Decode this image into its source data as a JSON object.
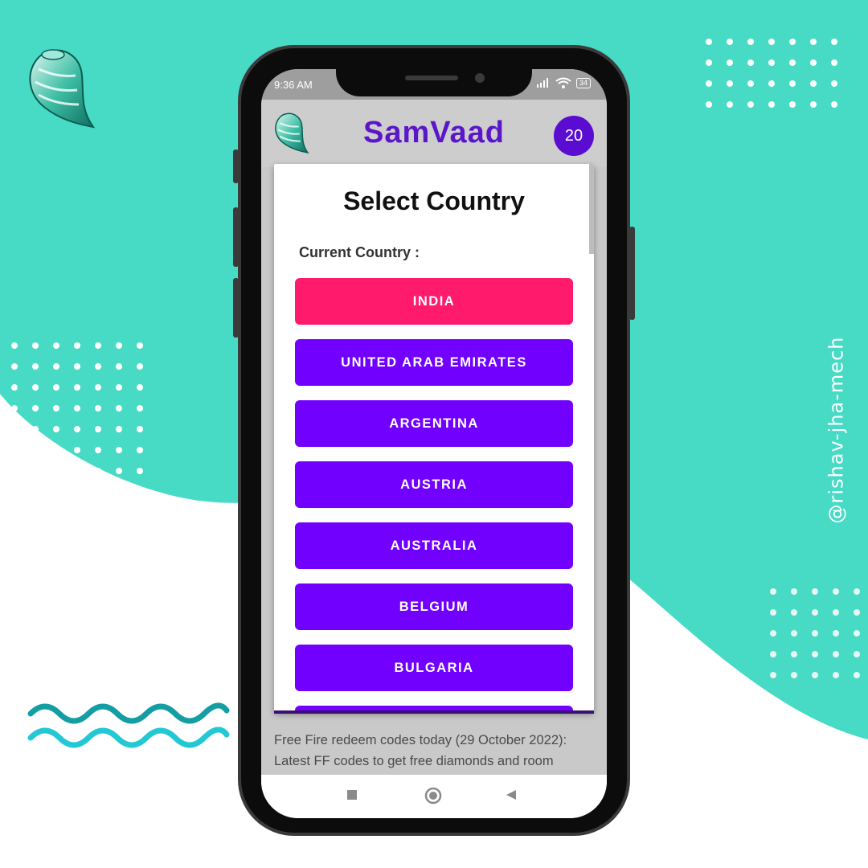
{
  "colors": {
    "teal_bg": "#47dbc6",
    "brand_purple": "#5a16c8",
    "button_purple": "#7100ff",
    "button_pink": "#ff1a6c"
  },
  "watermark": "@rishav-jha-mech",
  "status_bar": {
    "time": "9:36 AM",
    "battery": "34"
  },
  "app_bar": {
    "title": "SamVaad",
    "count": "20"
  },
  "dialog": {
    "title": "Select Country",
    "current_label": "Current Country :",
    "countries": [
      {
        "label": "INDIA",
        "selected": true
      },
      {
        "label": "UNITED ARAB EMIRATES",
        "selected": false
      },
      {
        "label": "ARGENTINA",
        "selected": false
      },
      {
        "label": "AUSTRIA",
        "selected": false
      },
      {
        "label": "AUSTRALIA",
        "selected": false
      },
      {
        "label": "BELGIUM",
        "selected": false
      },
      {
        "label": "BULGARIA",
        "selected": false
      }
    ]
  },
  "news": {
    "text": "Free Fire redeem codes today (29 October 2022): Latest FF codes to get free diamonds and room"
  },
  "nav": {
    "icons": [
      "recents-square-icon",
      "home-circle-icon",
      "back-triangle-icon"
    ]
  }
}
